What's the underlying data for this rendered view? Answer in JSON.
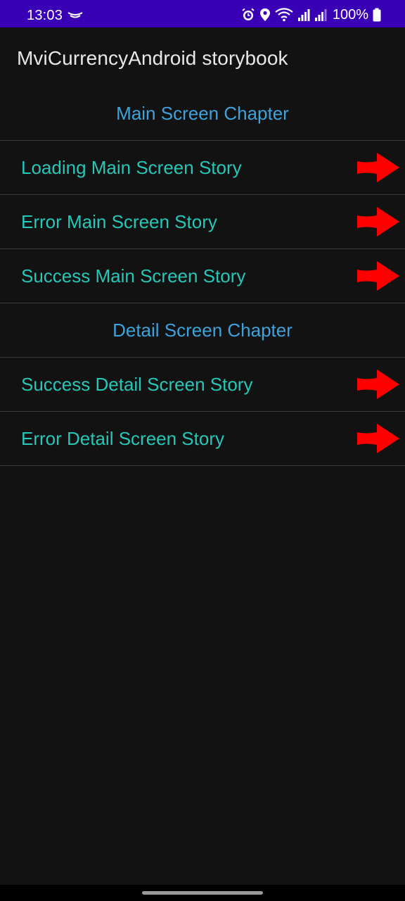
{
  "status_bar": {
    "time": "13:03",
    "battery_percent": "100%",
    "icons": [
      "notification-icon",
      "alarm-icon",
      "location-icon",
      "wifi-icon",
      "signal-icon",
      "signal-icon",
      "battery-icon"
    ],
    "background_color": "#3a00b6"
  },
  "toolbar": {
    "title": "MviCurrencyAndroid storybook"
  },
  "chapters": [
    {
      "title": "Main Screen Chapter",
      "stories": [
        {
          "label": "Loading Main Screen Story",
          "icon": "arrow-right-icon"
        },
        {
          "label": "Error Main Screen Story",
          "icon": "arrow-right-icon"
        },
        {
          "label": "Success Main Screen Story",
          "icon": "arrow-right-icon"
        }
      ]
    },
    {
      "title": "Detail Screen Chapter",
      "stories": [
        {
          "label": "Success Detail Screen Story",
          "icon": "arrow-right-icon"
        },
        {
          "label": "Error Detail Screen Story",
          "icon": "arrow-right-icon"
        }
      ]
    }
  ],
  "colors": {
    "background": "#121212",
    "chapter_text": "#3ea3dc",
    "story_text": "#25c7b8",
    "arrow": "#ff0000",
    "divider": "#3a3a3a"
  }
}
